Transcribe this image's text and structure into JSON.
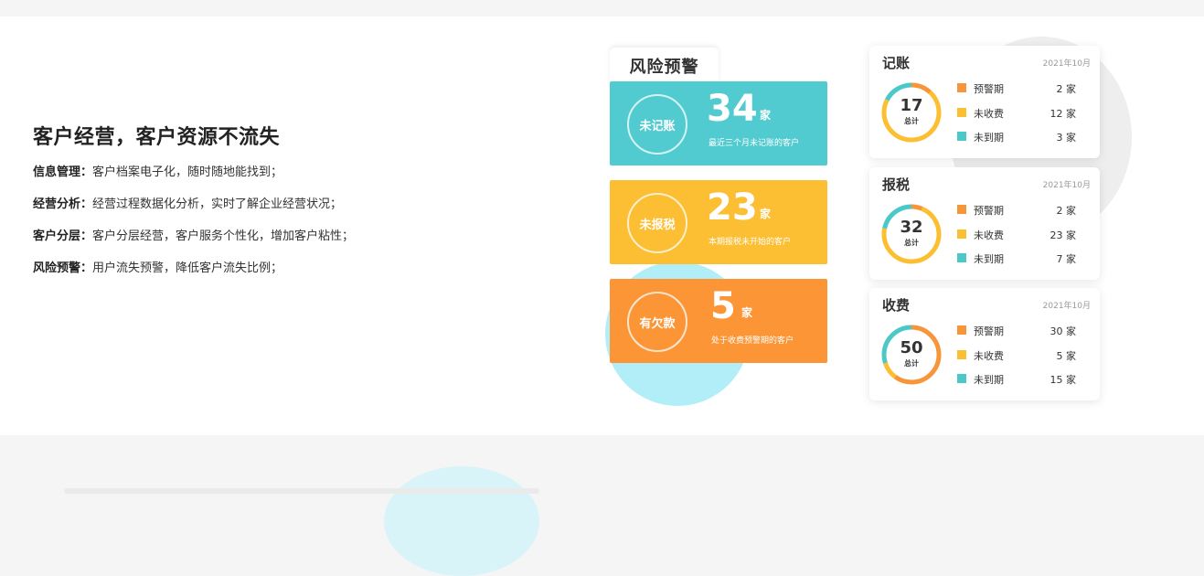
{
  "feature": {
    "title": "客户经营，客户资源不流失",
    "items": [
      {
        "label": "信息管理：",
        "text": "客户档案电子化，随时随地能找到；"
      },
      {
        "label": "经营分析：",
        "text": "经营过程数据化分析，实时了解企业经营状况；"
      },
      {
        "label": "客户分层：",
        "text": "客户分层经营，客户服务个性化，增加客户粘性；"
      },
      {
        "label": "风险预警：",
        "text": "用户流失预警，降低客户流失比例；"
      }
    ]
  },
  "warning": {
    "tab_title": "风险预警",
    "cards": [
      {
        "badge": "未记账",
        "count": "34",
        "unit": "家",
        "desc": "最近三个月未记账的客户",
        "color": "#52cbd0"
      },
      {
        "badge": "未报税",
        "count": "23",
        "unit": "家",
        "desc": "本期报税未开始的客户",
        "color": "#fcbe32"
      },
      {
        "badge": "有欠款",
        "count": "5",
        "unit": "家",
        "desc": "处于收费预警期的客户",
        "color": "#fc9536"
      }
    ]
  },
  "stats": {
    "colors": {
      "warning": "#f7953a",
      "unpaid": "#fcbf32",
      "notdue": "#4cc8c8"
    },
    "cards": [
      {
        "title": "记账",
        "date": "2021年10月",
        "total": "17",
        "total_label": "总计",
        "rows": [
          {
            "label": "预警期",
            "value": "2",
            "unit": "家",
            "key": "warning"
          },
          {
            "label": "未收费",
            "value": "12",
            "unit": "家",
            "key": "unpaid"
          },
          {
            "label": "未到期",
            "value": "3",
            "unit": "家",
            "key": "notdue"
          }
        ]
      },
      {
        "title": "报税",
        "date": "2021年10月",
        "total": "32",
        "total_label": "总计",
        "rows": [
          {
            "label": "预警期",
            "value": "2",
            "unit": "家",
            "key": "warning"
          },
          {
            "label": "未收费",
            "value": "23",
            "unit": "家",
            "key": "unpaid"
          },
          {
            "label": "未到期",
            "value": "7",
            "unit": "家",
            "key": "notdue"
          }
        ]
      },
      {
        "title": "收费",
        "date": "2021年10月",
        "total": "50",
        "total_label": "总计",
        "rows": [
          {
            "label": "预警期",
            "value": "30",
            "unit": "家",
            "key": "warning"
          },
          {
            "label": "未收费",
            "value": "5",
            "unit": "家",
            "key": "unpaid"
          },
          {
            "label": "未到期",
            "value": "15",
            "unit": "家",
            "key": "notdue"
          }
        ]
      }
    ]
  }
}
